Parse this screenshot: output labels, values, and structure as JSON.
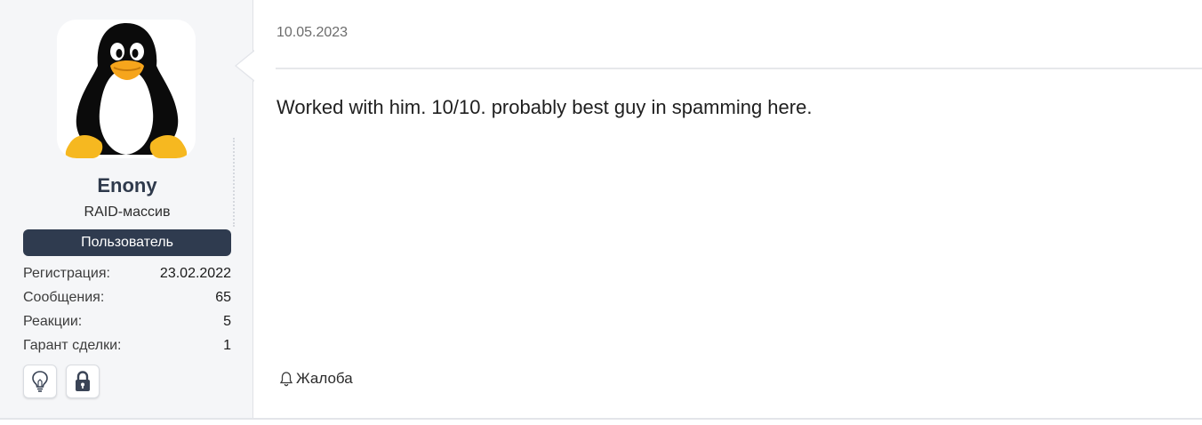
{
  "user": {
    "name": "Enony",
    "title": "RAID-массив",
    "banner": "Пользователь",
    "stats": [
      {
        "label": "Регистрация:",
        "value": "23.02.2022"
      },
      {
        "label": "Сообщения:",
        "value": "65"
      },
      {
        "label": "Реакции:",
        "value": "5"
      },
      {
        "label": "Гарант сделки:",
        "value": "1"
      }
    ],
    "badges": [
      "lightbulb-icon",
      "lock-icon"
    ]
  },
  "post": {
    "date": "10.05.2023",
    "content": "Worked with him. 10/10. probably best guy in spamming here.",
    "report_label": "Жалоба"
  },
  "colors": {
    "banner_bg": "#2f3b4f",
    "sidebar_bg": "#f5f6f8",
    "username": "#2f3a4c"
  }
}
